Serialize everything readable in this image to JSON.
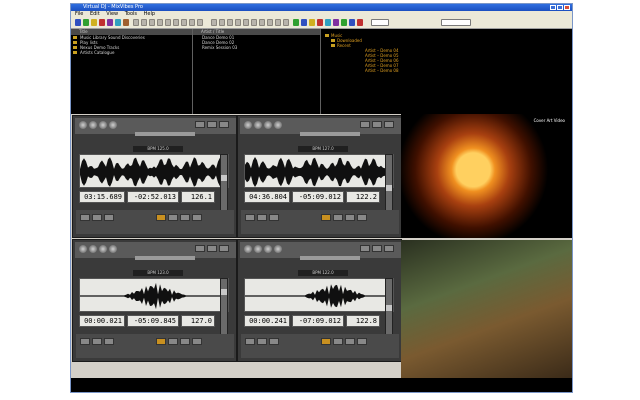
{
  "window": {
    "title": "Virtual DJ - MixVibes Pro",
    "menu": [
      "File",
      "Edit",
      "View",
      "Tools",
      "Help"
    ]
  },
  "browser": {
    "folders_header": "Title",
    "folders": [
      "Music Library Sound Discoveries",
      "Play lists",
      "Nexus Demo Tracks",
      "Artists Catalogue"
    ],
    "tracks_header": "Artist / Title",
    "tracks": [
      "Dance Demo  01",
      "Dance Demo  02",
      "Remix Session 03"
    ],
    "tree_items": [
      "Music",
      "Downloaded",
      "Recent",
      "Artist – Demo 04",
      "Artist – Demo 05",
      "Artist – Demo 06",
      "Artist – Demo 07",
      "Artist – Demo 08"
    ]
  },
  "decks": [
    {
      "id": "1",
      "bpm_label": "BPM 125.0",
      "elapsed": "03:15.689",
      "remaining": "-02:52.013",
      "pitch": "126.1"
    },
    {
      "id": "2",
      "bpm_label": "BPM 127.0",
      "elapsed": "04:36.804",
      "remaining": "-05:09.012",
      "pitch": "122.2"
    },
    {
      "id": "3",
      "bpm_label": "BPM 123.0",
      "elapsed": "00:00.021",
      "remaining": "-05:09.845",
      "pitch": "127.0"
    },
    {
      "id": "4",
      "bpm_label": "BPM 122.0",
      "elapsed": "00:00.241",
      "remaining": "-07:09.012",
      "pitch": "122.8"
    }
  ],
  "video": {
    "screen1_title": "Cover Art Video",
    "screen2_title": ""
  },
  "colors": {
    "deck_bg": "#3a3a3a",
    "browser_bg": "#000000",
    "tree_text": "#e0a020",
    "titlebar": "#2f6fe0"
  }
}
